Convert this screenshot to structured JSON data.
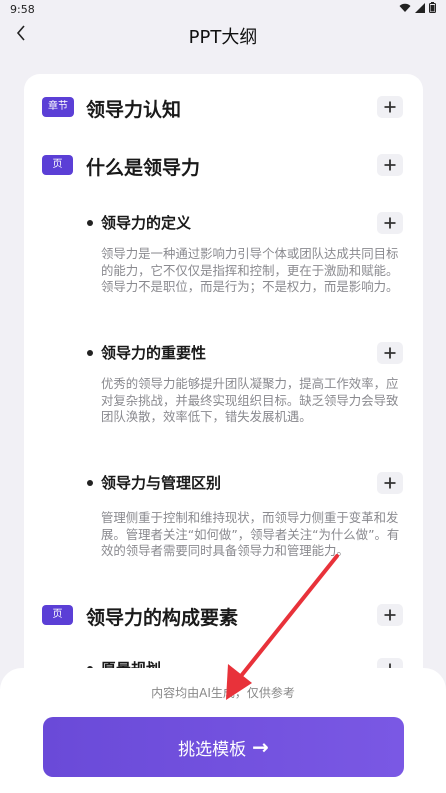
{
  "status": {
    "time": "9:58"
  },
  "header": {
    "title": "PPT大纲"
  },
  "outline": {
    "chapter": {
      "tag": "章节",
      "title": "领导力认知"
    },
    "page1": {
      "tag": "页",
      "title": "什么是领导力"
    },
    "items": [
      {
        "title": "领导力的定义",
        "body": "领导力是一种通过影响力引导个体或团队达成共同目标的能力，它不仅仅是指挥和控制，更在于激励和赋能。领导力不是职位，而是行为；不是权力，而是影响力。"
      },
      {
        "title": "领导力的重要性",
        "body": "优秀的领导力能够提升团队凝聚力，提高工作效率，应对复杂挑战，并最终实现组织目标。缺乏领导力会导致团队涣散，效率低下，错失发展机遇。"
      },
      {
        "title": "领导力与管理区别",
        "body": "管理侧重于控制和维持现状，而领导力侧重于变革和发展。管理者关注“如何做”，领导者关注“为什么做”。有效的领导者需要同时具备领导力和管理能力。"
      }
    ],
    "page2": {
      "tag": "页",
      "title": "领导力的构成要素"
    },
    "partial_title": "愿景规划"
  },
  "footer": {
    "disclaimer": "内容均由AI生成，仅供参考",
    "cta_label": "挑选模板",
    "cta_arrow": "→"
  },
  "colors": {
    "accent": "#5b3fd6",
    "annotation_arrow": "#e8323a"
  }
}
